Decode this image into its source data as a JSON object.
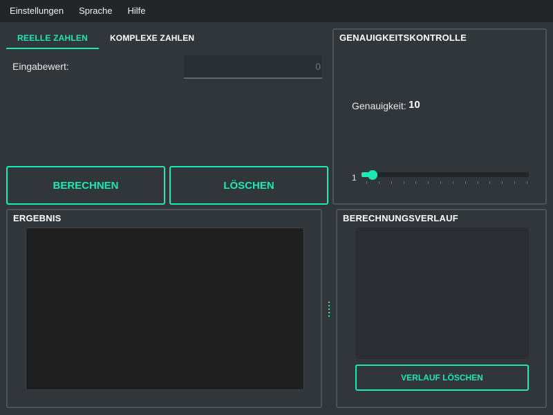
{
  "menubar": {
    "items": [
      "Einstellungen",
      "Sprache",
      "Hilfe"
    ]
  },
  "tabs": [
    {
      "label": "REELLE ZAHLEN",
      "active": true
    },
    {
      "label": "KOMPLEXE ZAHLEN",
      "active": false
    }
  ],
  "input": {
    "label": "Eingabewert:",
    "placeholder": "0"
  },
  "buttons": {
    "calculate": "BERECHNEN",
    "clear": "LÖSCHEN"
  },
  "precision": {
    "title": "GENAUIGKEITSKONTROLLE",
    "label": "Genauigkeit:",
    "value": "10",
    "slider_min_label": "1",
    "slider_level": 0.04
  },
  "result": {
    "title": "ERGEBNIS"
  },
  "history": {
    "title": "BERECHNUNGSVERLAUF",
    "clear_button": "VERLAUF LÖSCHEN"
  },
  "colors": {
    "accent": "#1de9b6",
    "background": "#31363b",
    "menubar": "#232629"
  }
}
